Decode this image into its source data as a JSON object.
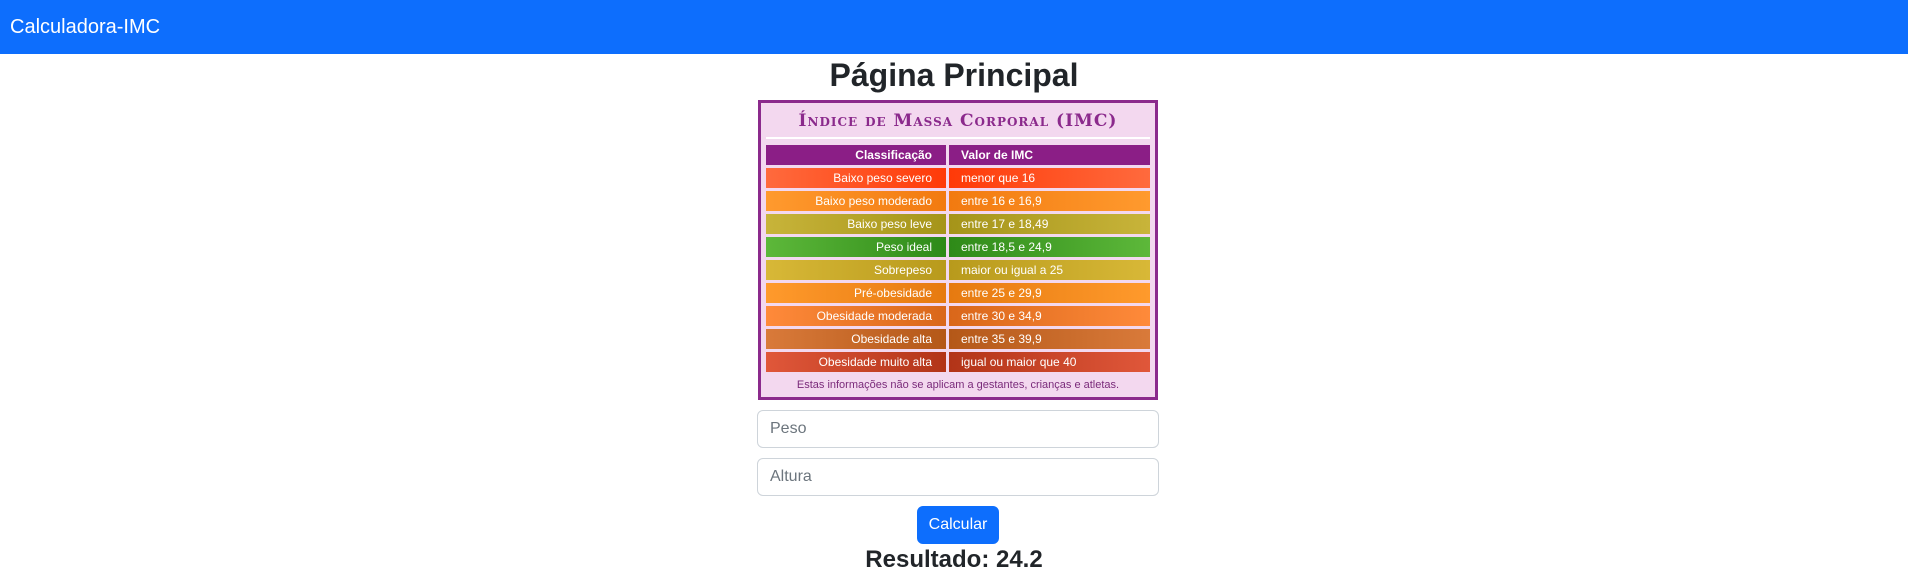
{
  "navbar": {
    "brand": "Calculadora-IMC"
  },
  "page": {
    "title": "Página Principal"
  },
  "imc_table": {
    "title": "Índice de Massa Corporal (IMC)",
    "headers": [
      "Classificação",
      "Valor de IMC"
    ],
    "rows": [
      {
        "label": "Baixo peso severo",
        "value": "menor que 16",
        "colors": [
          "#ff6a3d",
          "#ff3a08"
        ]
      },
      {
        "label": "Baixo peso moderado",
        "value": "entre 16 e 16,9",
        "colors": [
          "#ff9a2e",
          "#f27a10"
        ]
      },
      {
        "label": "Baixo peso leve",
        "value": "entre 17 e 18,49",
        "colors": [
          "#c8b43a",
          "#a59419"
        ]
      },
      {
        "label": "Peso ideal",
        "value": "entre 18,5 e 24,9",
        "colors": [
          "#5db83a",
          "#2e8a18"
        ]
      },
      {
        "label": "Sobrepeso",
        "value": "maior ou igual a 25",
        "colors": [
          "#d8b837",
          "#b89a1c"
        ]
      },
      {
        "label": "Pré-obesidade",
        "value": "entre 25 e 29,9",
        "colors": [
          "#ff9a2c",
          "#e67a10"
        ]
      },
      {
        "label": "Obesidade moderada",
        "value": "entre 30 e 34,9",
        "colors": [
          "#ff8a3a",
          "#d9671a"
        ]
      },
      {
        "label": "Obesidade alta",
        "value": "entre  35 e 39,9",
        "colors": [
          "#d97a3a",
          "#b45818"
        ]
      },
      {
        "label": "Obesidade muito alta",
        "value": "igual ou maior que 40",
        "colors": [
          "#e0573a",
          "#b23418"
        ]
      }
    ],
    "note": "Estas informações não se aplicam a gestantes, crianças e atletas."
  },
  "form": {
    "peso_placeholder": "Peso",
    "altura_placeholder": "Altura",
    "button_label": "Calcular"
  },
  "result": {
    "text": "Resultado: 24.2"
  }
}
